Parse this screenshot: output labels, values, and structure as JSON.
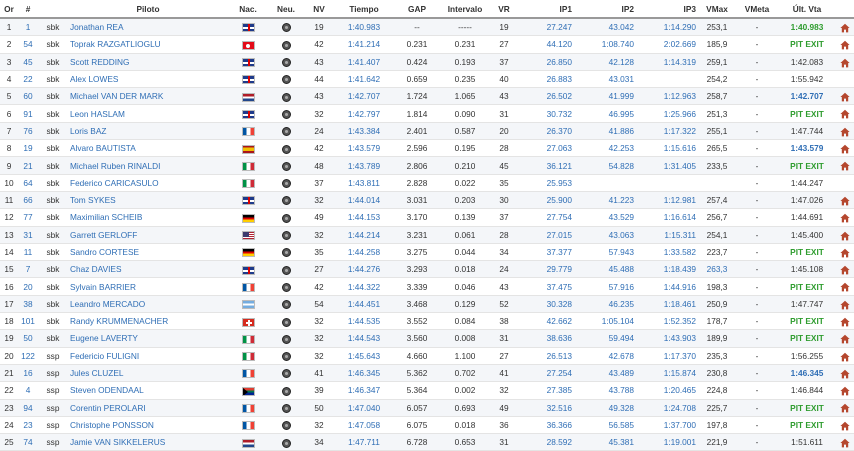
{
  "columns": [
    "Or",
    "#",
    "",
    "Piloto",
    "Nac.",
    "Neu.",
    "NV",
    "Tiempo",
    "GAP",
    "Intervalo",
    "VR",
    "IP1",
    "IP2",
    "IP3",
    "VMax",
    "VMeta",
    "Últ. Vta"
  ],
  "colors": {
    "link": "#2f6eb5",
    "pit": "#2e9c2e",
    "home_icon": "#b5472e"
  },
  "rows": [
    {
      "pos": "1",
      "num": "1",
      "cls": "sbk",
      "rider": "Jonathan REA",
      "nat": "gbr",
      "tyre": "tyre-icon",
      "laps": "19",
      "time": "1:40.983",
      "gap": "--",
      "interval": "-----",
      "vr": "19",
      "ip1": "27.247",
      "ip2": "43.042",
      "ip3": "1:14.290",
      "vmax": "253,1",
      "vmeta": "-",
      "last": "1:40.983",
      "last_style": "green",
      "home": true
    },
    {
      "pos": "2",
      "num": "54",
      "cls": "sbk",
      "rider": "Toprak RAZGATLIOGLU",
      "nat": "tur",
      "tyre": "tyre-icon",
      "laps": "42",
      "time": "1:41.214",
      "gap": "0.231",
      "interval": "0.231",
      "vr": "27",
      "ip1": "44.120",
      "ip2": "1:08.740",
      "ip3": "2:02.669",
      "vmax": "185,9",
      "vmeta": "-",
      "last": "PIT EXIT",
      "last_style": "green",
      "home": true
    },
    {
      "pos": "3",
      "num": "45",
      "cls": "sbk",
      "rider": "Scott REDDING",
      "nat": "gbr",
      "tyre": "tyre-icon",
      "laps": "43",
      "time": "1:41.407",
      "gap": "0.424",
      "interval": "0.193",
      "vr": "37",
      "ip1": "26.850",
      "ip2": "42.128",
      "ip3": "1:14.319",
      "vmax": "259,1",
      "vmeta": "-",
      "last": "1:42.083",
      "last_style": "plain",
      "home": true
    },
    {
      "pos": "4",
      "num": "22",
      "cls": "sbk",
      "rider": "Alex LOWES",
      "nat": "gbr",
      "tyre": "tyre-icon",
      "laps": "44",
      "time": "1:41.642",
      "gap": "0.659",
      "interval": "0.235",
      "vr": "40",
      "ip1": "26.883",
      "ip2": "43.031",
      "ip3": "",
      "vmax": "254,2",
      "vmeta": "-",
      "last": "1:55.942",
      "last_style": "plain",
      "home": false
    },
    {
      "pos": "5",
      "num": "60",
      "cls": "sbk",
      "rider": "Michael VAN DER MARK",
      "nat": "ned",
      "tyre": "tyre-icon",
      "laps": "43",
      "time": "1:42.707",
      "gap": "1.724",
      "interval": "1.065",
      "vr": "43",
      "ip1": "26.502",
      "ip2": "41.999",
      "ip3": "1:12.963",
      "vmax": "258,7",
      "vmeta": "-",
      "last": "1:42.707",
      "last_style": "blue",
      "home": true
    },
    {
      "pos": "6",
      "num": "91",
      "cls": "sbk",
      "rider": "Leon HASLAM",
      "nat": "gbr",
      "tyre": "tyre-icon",
      "laps": "32",
      "time": "1:42.797",
      "gap": "1.814",
      "interval": "0.090",
      "vr": "31",
      "ip1": "30.732",
      "ip2": "46.995",
      "ip3": "1:25.966",
      "vmax": "251,3",
      "vmeta": "-",
      "last": "PIT EXIT",
      "last_style": "green",
      "home": true
    },
    {
      "pos": "7",
      "num": "76",
      "cls": "sbk",
      "rider": "Loris BAZ",
      "nat": "fra",
      "tyre": "tyre-icon",
      "laps": "24",
      "time": "1:43.384",
      "gap": "2.401",
      "interval": "0.587",
      "vr": "20",
      "ip1": "26.370",
      "ip2": "41.886",
      "ip3": "1:17.322",
      "vmax": "255,1",
      "vmeta": "-",
      "last": "1:47.744",
      "last_style": "plain",
      "home": true
    },
    {
      "pos": "8",
      "num": "19",
      "cls": "sbk",
      "rider": "Alvaro BAUTISTA",
      "nat": "esp",
      "tyre": "tyre-icon",
      "laps": "42",
      "time": "1:43.579",
      "gap": "2.596",
      "interval": "0.195",
      "vr": "28",
      "ip1": "27.063",
      "ip2": "42.253",
      "ip3": "1:15.616",
      "vmax": "265,5",
      "vmeta": "-",
      "last": "1:43.579",
      "last_style": "blue",
      "home": true
    },
    {
      "pos": "9",
      "num": "21",
      "cls": "sbk",
      "rider": "Michael Ruben RINALDI",
      "nat": "ita",
      "tyre": "tyre-icon",
      "laps": "48",
      "time": "1:43.789",
      "gap": "2.806",
      "interval": "0.210",
      "vr": "45",
      "ip1": "36.121",
      "ip2": "54.828",
      "ip3": "1:31.405",
      "vmax": "233,5",
      "vmeta": "-",
      "last": "PIT EXIT",
      "last_style": "green",
      "home": true
    },
    {
      "pos": "10",
      "num": "64",
      "cls": "sbk",
      "rider": "Federico CARICASULO",
      "nat": "ita",
      "tyre": "tyre-icon",
      "laps": "37",
      "time": "1:43.811",
      "gap": "2.828",
      "interval": "0.022",
      "vr": "35",
      "ip1": "25.953",
      "ip2": "",
      "ip3": "",
      "vmax": "",
      "vmeta": "-",
      "last": "1:44.247",
      "last_style": "plain",
      "home": false
    },
    {
      "pos": "11",
      "num": "66",
      "cls": "sbk",
      "rider": "Tom SYKES",
      "nat": "gbr",
      "tyre": "tyre-icon",
      "laps": "32",
      "time": "1:44.014",
      "gap": "3.031",
      "interval": "0.203",
      "vr": "30",
      "ip1": "25.900",
      "ip2": "41.223",
      "ip3": "1:12.981",
      "vmax": "257,4",
      "vmeta": "-",
      "last": "1:47.026",
      "last_style": "plain",
      "home": true
    },
    {
      "pos": "12",
      "num": "77",
      "cls": "sbk",
      "rider": "Maximilian SCHEIB",
      "nat": "ger",
      "tyre": "tyre-icon",
      "laps": "49",
      "time": "1:44.153",
      "gap": "3.170",
      "interval": "0.139",
      "vr": "37",
      "ip1": "27.754",
      "ip2": "43.529",
      "ip3": "1:16.614",
      "vmax": "256,7",
      "vmeta": "-",
      "last": "1:44.691",
      "last_style": "plain",
      "home": true
    },
    {
      "pos": "13",
      "num": "31",
      "cls": "sbk",
      "rider": "Garrett GERLOFF",
      "nat": "usa",
      "tyre": "tyre-icon",
      "laps": "32",
      "time": "1:44.214",
      "gap": "3.231",
      "interval": "0.061",
      "vr": "28",
      "ip1": "27.015",
      "ip2": "43.063",
      "ip3": "1:15.311",
      "vmax": "254,1",
      "vmeta": "-",
      "last": "1:45.400",
      "last_style": "plain",
      "home": true
    },
    {
      "pos": "14",
      "num": "11",
      "cls": "sbk",
      "rider": "Sandro CORTESE",
      "nat": "ger",
      "tyre": "tyre-icon",
      "laps": "35",
      "time": "1:44.258",
      "gap": "3.275",
      "interval": "0.044",
      "vr": "34",
      "ip1": "37.377",
      "ip2": "57.943",
      "ip3": "1:33.582",
      "vmax": "223,7",
      "vmeta": "-",
      "last": "PIT EXIT",
      "last_style": "green",
      "home": true
    },
    {
      "pos": "15",
      "num": "7",
      "cls": "sbk",
      "rider": "Chaz DAVIES",
      "nat": "gbr",
      "tyre": "tyre-icon",
      "laps": "27",
      "time": "1:44.276",
      "gap": "3.293",
      "interval": "0.018",
      "vr": "24",
      "ip1": "29.779",
      "ip2": "45.488",
      "ip3": "1:18.439",
      "vmax": "263,3",
      "vmeta": "-",
      "last": "1:45.108",
      "last_style": "plain",
      "vmax_blue": true,
      "home": true
    },
    {
      "pos": "16",
      "num": "20",
      "cls": "sbk",
      "rider": "Sylvain BARRIER",
      "nat": "fra",
      "tyre": "tyre-icon",
      "laps": "42",
      "time": "1:44.322",
      "gap": "3.339",
      "interval": "0.046",
      "vr": "43",
      "ip1": "37.475",
      "ip2": "57.916",
      "ip3": "1:44.916",
      "vmax": "198,3",
      "vmeta": "-",
      "last": "PIT EXIT",
      "last_style": "green",
      "home": true
    },
    {
      "pos": "17",
      "num": "38",
      "cls": "sbk",
      "rider": "Leandro MERCADO",
      "nat": "arg",
      "tyre": "tyre-icon",
      "laps": "54",
      "time": "1:44.451",
      "gap": "3.468",
      "interval": "0.129",
      "vr": "52",
      "ip1": "30.328",
      "ip2": "46.235",
      "ip3": "1:18.461",
      "vmax": "250,9",
      "vmeta": "-",
      "last": "1:47.747",
      "last_style": "plain",
      "home": true
    },
    {
      "pos": "18",
      "num": "101",
      "cls": "sbk",
      "rider": "Randy KRUMMENACHER",
      "nat": "sui",
      "tyre": "tyre-icon",
      "laps": "32",
      "time": "1:44.535",
      "gap": "3.552",
      "interval": "0.084",
      "vr": "38",
      "ip1": "42.662",
      "ip2": "1:05.104",
      "ip3": "1:52.352",
      "vmax": "178,7",
      "vmeta": "-",
      "last": "PIT EXIT",
      "last_style": "green",
      "home": true
    },
    {
      "pos": "19",
      "num": "50",
      "cls": "sbk",
      "rider": "Eugene LAVERTY",
      "nat": "ita",
      "tyre": "tyre-icon",
      "laps": "32",
      "time": "1:44.543",
      "gap": "3.560",
      "interval": "0.008",
      "vr": "31",
      "ip1": "38.636",
      "ip2": "59.494",
      "ip3": "1:43.903",
      "vmax": "189,9",
      "vmeta": "-",
      "last": "PIT EXIT",
      "last_style": "green",
      "home": true
    },
    {
      "pos": "20",
      "num": "122",
      "cls": "ssp",
      "rider": "Federicio FULIGNI",
      "nat": "ita",
      "tyre": "tyre-icon",
      "laps": "32",
      "time": "1:45.643",
      "gap": "4.660",
      "interval": "1.100",
      "vr": "27",
      "ip1": "26.513",
      "ip2": "42.678",
      "ip3": "1:17.370",
      "vmax": "235,3",
      "vmeta": "-",
      "last": "1:56.255",
      "last_style": "plain",
      "home": true
    },
    {
      "pos": "21",
      "num": "16",
      "cls": "ssp",
      "rider": "Jules CLUZEL",
      "nat": "fra",
      "tyre": "tyre-icon",
      "laps": "41",
      "time": "1:46.345",
      "gap": "5.362",
      "interval": "0.702",
      "vr": "41",
      "ip1": "27.254",
      "ip2": "43.489",
      "ip3": "1:15.874",
      "vmax": "230,8",
      "vmeta": "-",
      "last": "1:46.345",
      "last_style": "blue",
      "home": true
    },
    {
      "pos": "22",
      "num": "4",
      "cls": "ssp",
      "rider": "Steven ODENDAAL",
      "nat": "rsa",
      "tyre": "tyre-icon",
      "laps": "39",
      "time": "1:46.347",
      "gap": "5.364",
      "interval": "0.002",
      "vr": "32",
      "ip1": "27.385",
      "ip2": "43.788",
      "ip3": "1:20.465",
      "vmax": "224,8",
      "vmeta": "-",
      "last": "1:46.844",
      "last_style": "plain",
      "home": true
    },
    {
      "pos": "23",
      "num": "94",
      "cls": "ssp",
      "rider": "Corentin PEROLARI",
      "nat": "fra",
      "tyre": "tyre-icon",
      "laps": "50",
      "time": "1:47.040",
      "gap": "6.057",
      "interval": "0.693",
      "vr": "49",
      "ip1": "32.516",
      "ip2": "49.328",
      "ip3": "1:24.708",
      "vmax": "225,7",
      "vmeta": "-",
      "last": "PIT EXIT",
      "last_style": "green",
      "home": true
    },
    {
      "pos": "24",
      "num": "23",
      "cls": "ssp",
      "rider": "Christophe PONSSON",
      "nat": "fra",
      "tyre": "tyre-icon",
      "laps": "32",
      "time": "1:47.058",
      "gap": "6.075",
      "interval": "0.018",
      "vr": "36",
      "ip1": "36.366",
      "ip2": "56.585",
      "ip3": "1:37.700",
      "vmax": "197,8",
      "vmeta": "-",
      "last": "PIT EXIT",
      "last_style": "green",
      "home": true
    },
    {
      "pos": "25",
      "num": "74",
      "cls": "ssp",
      "rider": "Jamie VAN SIKKELERUS",
      "nat": "ned",
      "tyre": "tyre-icon",
      "laps": "34",
      "time": "1:47.711",
      "gap": "6.728",
      "interval": "0.653",
      "vr": "31",
      "ip1": "28.592",
      "ip2": "45.381",
      "ip3": "1:19.001",
      "vmax": "221,9",
      "vmeta": "-",
      "last": "1:51.611",
      "last_style": "plain",
      "home": true
    }
  ]
}
